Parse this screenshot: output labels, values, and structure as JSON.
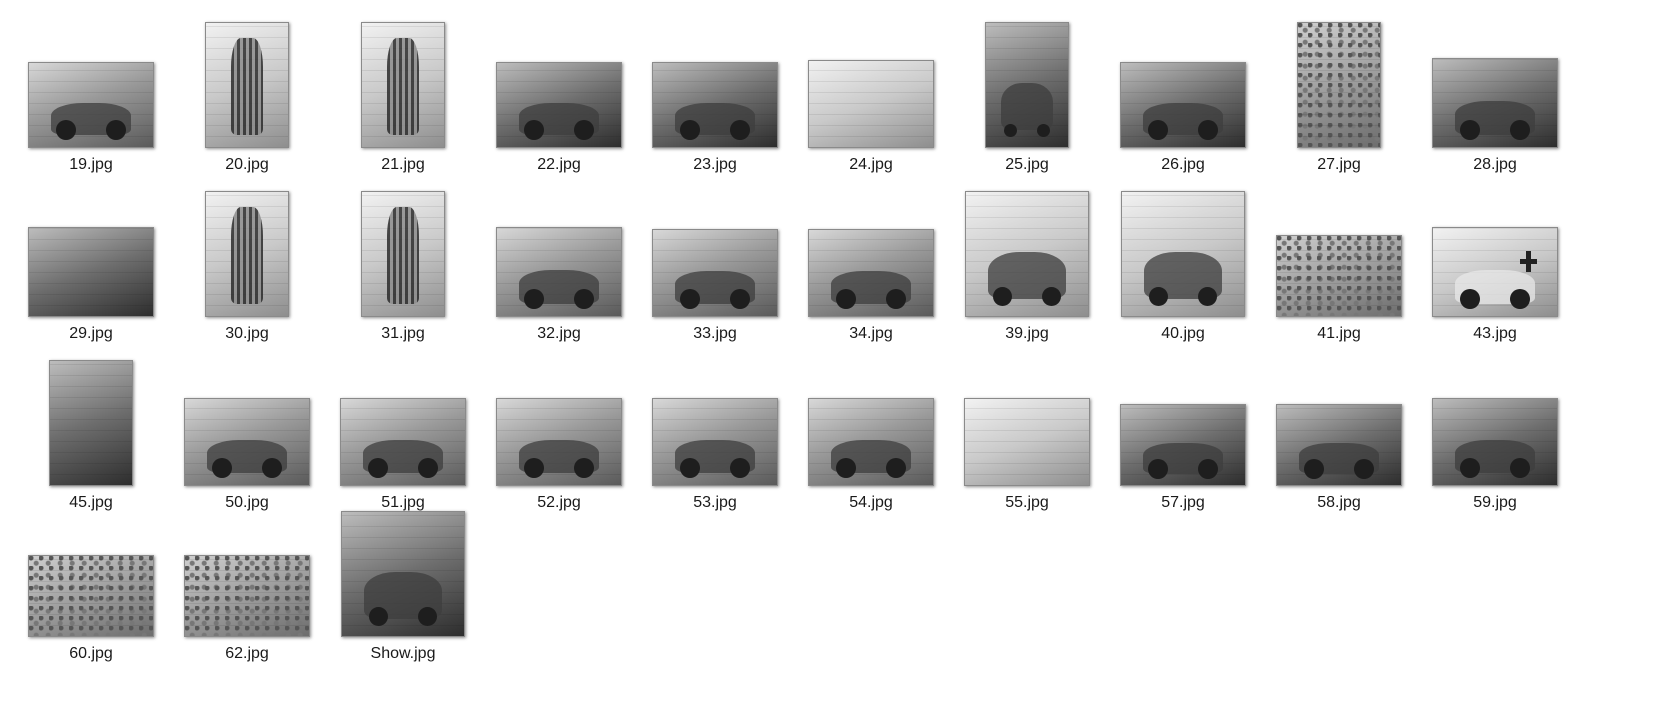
{
  "window": {
    "view": "Large icons"
  },
  "files": [
    {
      "name": "19.jpg",
      "icon": "car-photo-icon",
      "orient": "land"
    },
    {
      "name": "20.jpg",
      "icon": "grille-photo-icon",
      "orient": "port"
    },
    {
      "name": "21.jpg",
      "icon": "grille-photo-icon",
      "orient": "port"
    },
    {
      "name": "22.jpg",
      "icon": "armored-vehicle-photo-icon",
      "orient": "land"
    },
    {
      "name": "23.jpg",
      "icon": "truck-photo-icon",
      "orient": "land"
    },
    {
      "name": "24.jpg",
      "icon": "aerial-photo-icon",
      "orient": "land-short"
    },
    {
      "name": "25.jpg",
      "icon": "armored-vehicle-photo-icon",
      "orient": "port"
    },
    {
      "name": "26.jpg",
      "icon": "armored-vehicle-photo-icon",
      "orient": "land"
    },
    {
      "name": "27.jpg",
      "icon": "crowd-photo-icon",
      "orient": "port"
    },
    {
      "name": "28.jpg",
      "icon": "armored-vehicle-photo-icon",
      "orient": "land-border"
    },
    {
      "name": "29.jpg",
      "icon": "workshop-photo-icon",
      "orient": "land-border"
    },
    {
      "name": "30.jpg",
      "icon": "grille-photo-icon",
      "orient": "port"
    },
    {
      "name": "31.jpg",
      "icon": "grille-photo-icon",
      "orient": "port"
    },
    {
      "name": "32.jpg",
      "icon": "car-photo-icon",
      "orient": "land-border"
    },
    {
      "name": "33.jpg",
      "icon": "armored-car-photo-icon",
      "orient": "land-short"
    },
    {
      "name": "34.jpg",
      "icon": "car-photo-icon",
      "orient": "land-short"
    },
    {
      "name": "39.jpg",
      "icon": "people-photo-icon",
      "orient": "land-tall"
    },
    {
      "name": "40.jpg",
      "icon": "people-photo-icon",
      "orient": "land-tall"
    },
    {
      "name": "41.jpg",
      "icon": "crowd-photo-icon",
      "orient": "land-low"
    },
    {
      "name": "43.jpg",
      "icon": "ambulance-photo-icon",
      "orient": "land-border"
    },
    {
      "name": "45.jpg",
      "icon": "workshop-photo-icon",
      "orient": "port"
    },
    {
      "name": "50.jpg",
      "icon": "tanker-truck-photo-icon",
      "orient": "land-short"
    },
    {
      "name": "51.jpg",
      "icon": "tanker-truck-photo-icon",
      "orient": "land-short"
    },
    {
      "name": "52.jpg",
      "icon": "tanker-truck-photo-icon",
      "orient": "land-short"
    },
    {
      "name": "53.jpg",
      "icon": "van-photo-icon",
      "orient": "land-short"
    },
    {
      "name": "54.jpg",
      "icon": "van-photo-icon",
      "orient": "land-short"
    },
    {
      "name": "55.jpg",
      "icon": "market-photo-icon",
      "orient": "land-short"
    },
    {
      "name": "57.jpg",
      "icon": "truck-photo-icon",
      "orient": "land-low"
    },
    {
      "name": "58.jpg",
      "icon": "bus-photo-icon",
      "orient": "land-low"
    },
    {
      "name": "59.jpg",
      "icon": "truck-photo-icon",
      "orient": "land-short"
    },
    {
      "name": "60.jpg",
      "icon": "crowd-photo-icon",
      "orient": "land-low"
    },
    {
      "name": "62.jpg",
      "icon": "crowd-photo-icon",
      "orient": "land-low"
    },
    {
      "name": "Show.jpg",
      "icon": "truck-photo-icon",
      "orient": "land-tall"
    }
  ]
}
